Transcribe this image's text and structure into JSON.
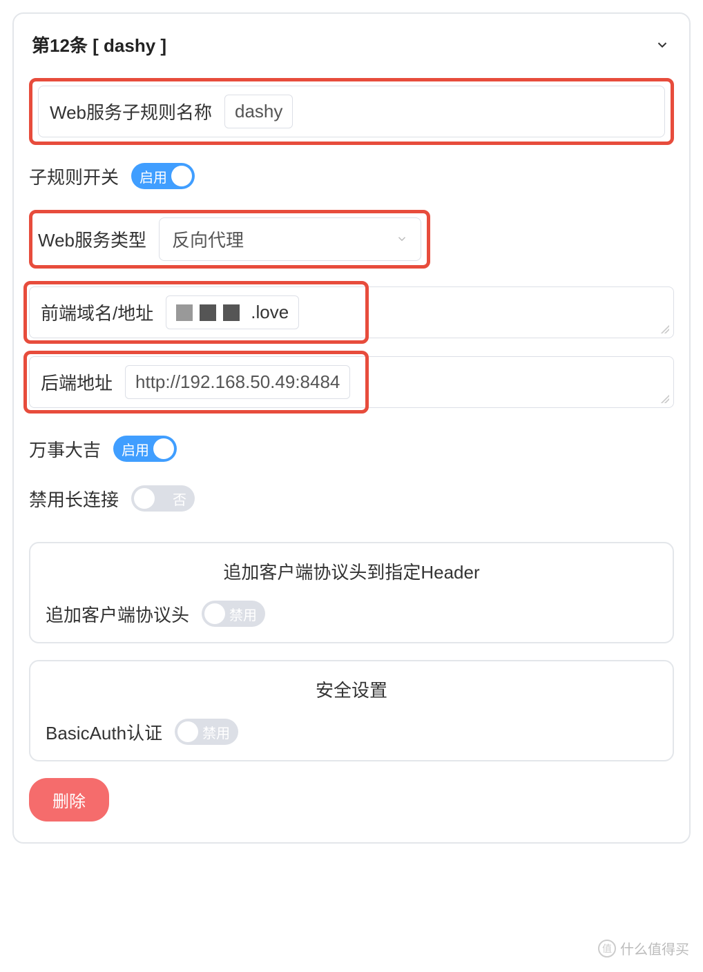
{
  "panel": {
    "title": "第12条 [ dashy ]"
  },
  "fields": {
    "rule_name": {
      "label": "Web服务子规则名称",
      "value": "dashy"
    },
    "rule_switch": {
      "label": "子规则开关",
      "state": "启用"
    },
    "service_type": {
      "label": "Web服务类型",
      "value": "反向代理"
    },
    "frontend": {
      "label": "前端域名/地址",
      "value_suffix": ".love"
    },
    "backend": {
      "label": "后端地址",
      "value": "http://192.168.50.49:8484"
    },
    "all_ok": {
      "label": "万事大吉",
      "state": "启用"
    },
    "disable_keepalive": {
      "label": "禁用长连接",
      "state": "否"
    }
  },
  "sub_panels": {
    "header_append": {
      "title": "追加客户端协议头到指定Header",
      "field_label": "追加客户端协议头",
      "state": "禁用"
    },
    "security": {
      "title": "安全设置",
      "field_label": "BasicAuth认证",
      "state": "禁用"
    }
  },
  "delete_label": "删除",
  "watermark": "什么值得买"
}
